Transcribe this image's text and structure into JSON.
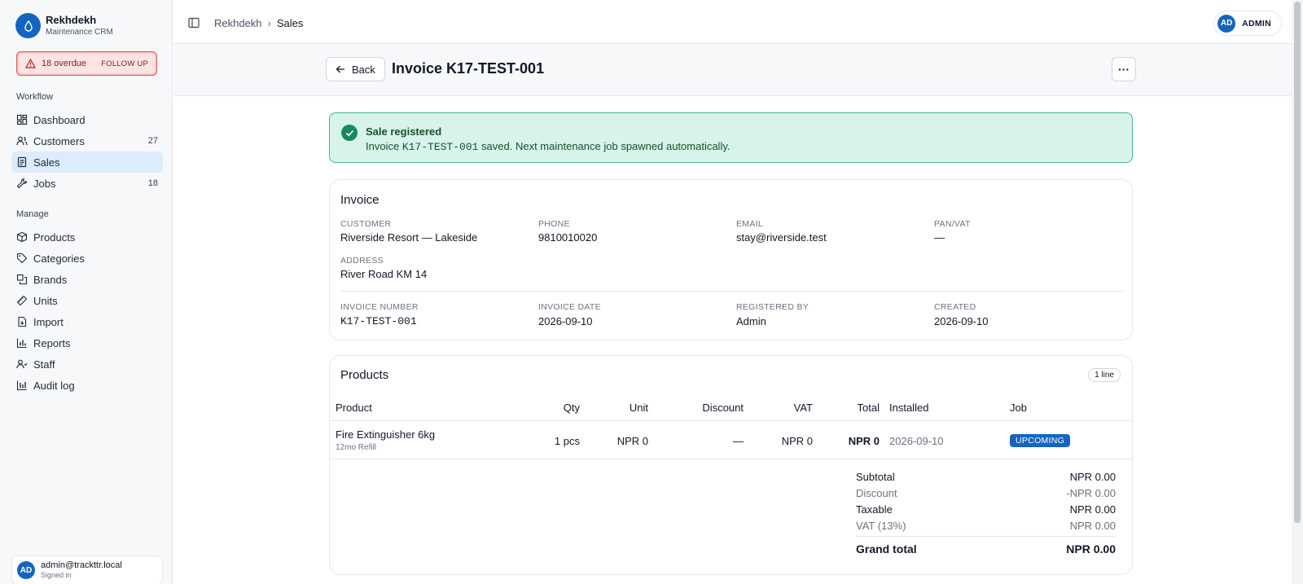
{
  "app": {
    "name": "Rekhdekh",
    "subtitle": "Maintenance CRM"
  },
  "overdue": {
    "count_text": "18 overdue",
    "action": "FOLLOW UP"
  },
  "sidebar": {
    "workflow_label": "Workflow",
    "workflow": [
      {
        "label": "Dashboard",
        "icon": "dashboard-icon",
        "count": ""
      },
      {
        "label": "Customers",
        "icon": "users-icon",
        "count": "27"
      },
      {
        "label": "Sales",
        "icon": "receipt-icon",
        "count": "",
        "active": true
      },
      {
        "label": "Jobs",
        "icon": "wrench-icon",
        "count": "18"
      }
    ],
    "manage_label": "Manage",
    "manage": [
      {
        "label": "Products",
        "icon": "box-icon"
      },
      {
        "label": "Categories",
        "icon": "tag-icon"
      },
      {
        "label": "Brands",
        "icon": "layers-icon"
      },
      {
        "label": "Units",
        "icon": "ruler-icon"
      },
      {
        "label": "Import",
        "icon": "file-import-icon"
      },
      {
        "label": "Reports",
        "icon": "bar-chart-icon"
      },
      {
        "label": "Staff",
        "icon": "staff-icon"
      },
      {
        "label": "Audit log",
        "icon": "audit-icon"
      }
    ]
  },
  "user": {
    "initials": "AD",
    "email": "admin@trackttr.local",
    "status": "Signed in"
  },
  "topbar": {
    "breadcrumb": [
      "Rekhdekh",
      "Sales"
    ],
    "avatar": "AD",
    "role": "ADMIN"
  },
  "header": {
    "back_label": "Back",
    "title": "Invoice K17-TEST-001",
    "more": "···"
  },
  "alert": {
    "title": "Sale registered",
    "body_pre": "Invoice ",
    "body_code": "K17-TEST-001",
    "body_post": " saved. Next maintenance job spawned automatically."
  },
  "invoice": {
    "title": "Invoice",
    "customer_label": "CUSTOMER",
    "customer": "Riverside Resort — Lakeside",
    "phone_label": "PHONE",
    "phone": "9810010020",
    "email_label": "EMAIL",
    "email": "stay@riverside.test",
    "pan_label": "PAN/VAT",
    "pan": "—",
    "address_label": "ADDRESS",
    "address": "River Road KM 14",
    "number_label": "INVOICE NUMBER",
    "number": "K17-TEST-001",
    "date_label": "INVOICE DATE",
    "date": "2026-09-10",
    "registered_label": "REGISTERED BY",
    "registered_by": "Admin",
    "created_label": "CREATED",
    "created": "2026-09-10"
  },
  "products": {
    "title": "Products",
    "lines_badge": "1 line",
    "columns": [
      "Product",
      "Qty",
      "Unit",
      "Discount",
      "VAT",
      "Total",
      "Installed",
      "Job"
    ],
    "rows": [
      {
        "product": "Fire Extinguisher 6kg",
        "sub": "12mo Refill",
        "qty": "1 pcs",
        "unit": "NPR 0",
        "discount": "—",
        "vat": "NPR 0",
        "total": "NPR 0",
        "installed": "2026-09-10",
        "job": "UPCOMING"
      }
    ],
    "totals": {
      "subtotal_label": "Subtotal",
      "subtotal": "NPR 0.00",
      "discount_label": "Discount",
      "discount": "-NPR 0.00",
      "taxable_label": "Taxable",
      "taxable": "NPR 0.00",
      "vat_label": "VAT (13%)",
      "vat": "NPR 0.00",
      "grand_label": "Grand total",
      "grand": "NPR 0.00"
    }
  },
  "colors": {
    "brand": "#1565c0",
    "danger": "#e05252",
    "success": "#178a5b"
  }
}
